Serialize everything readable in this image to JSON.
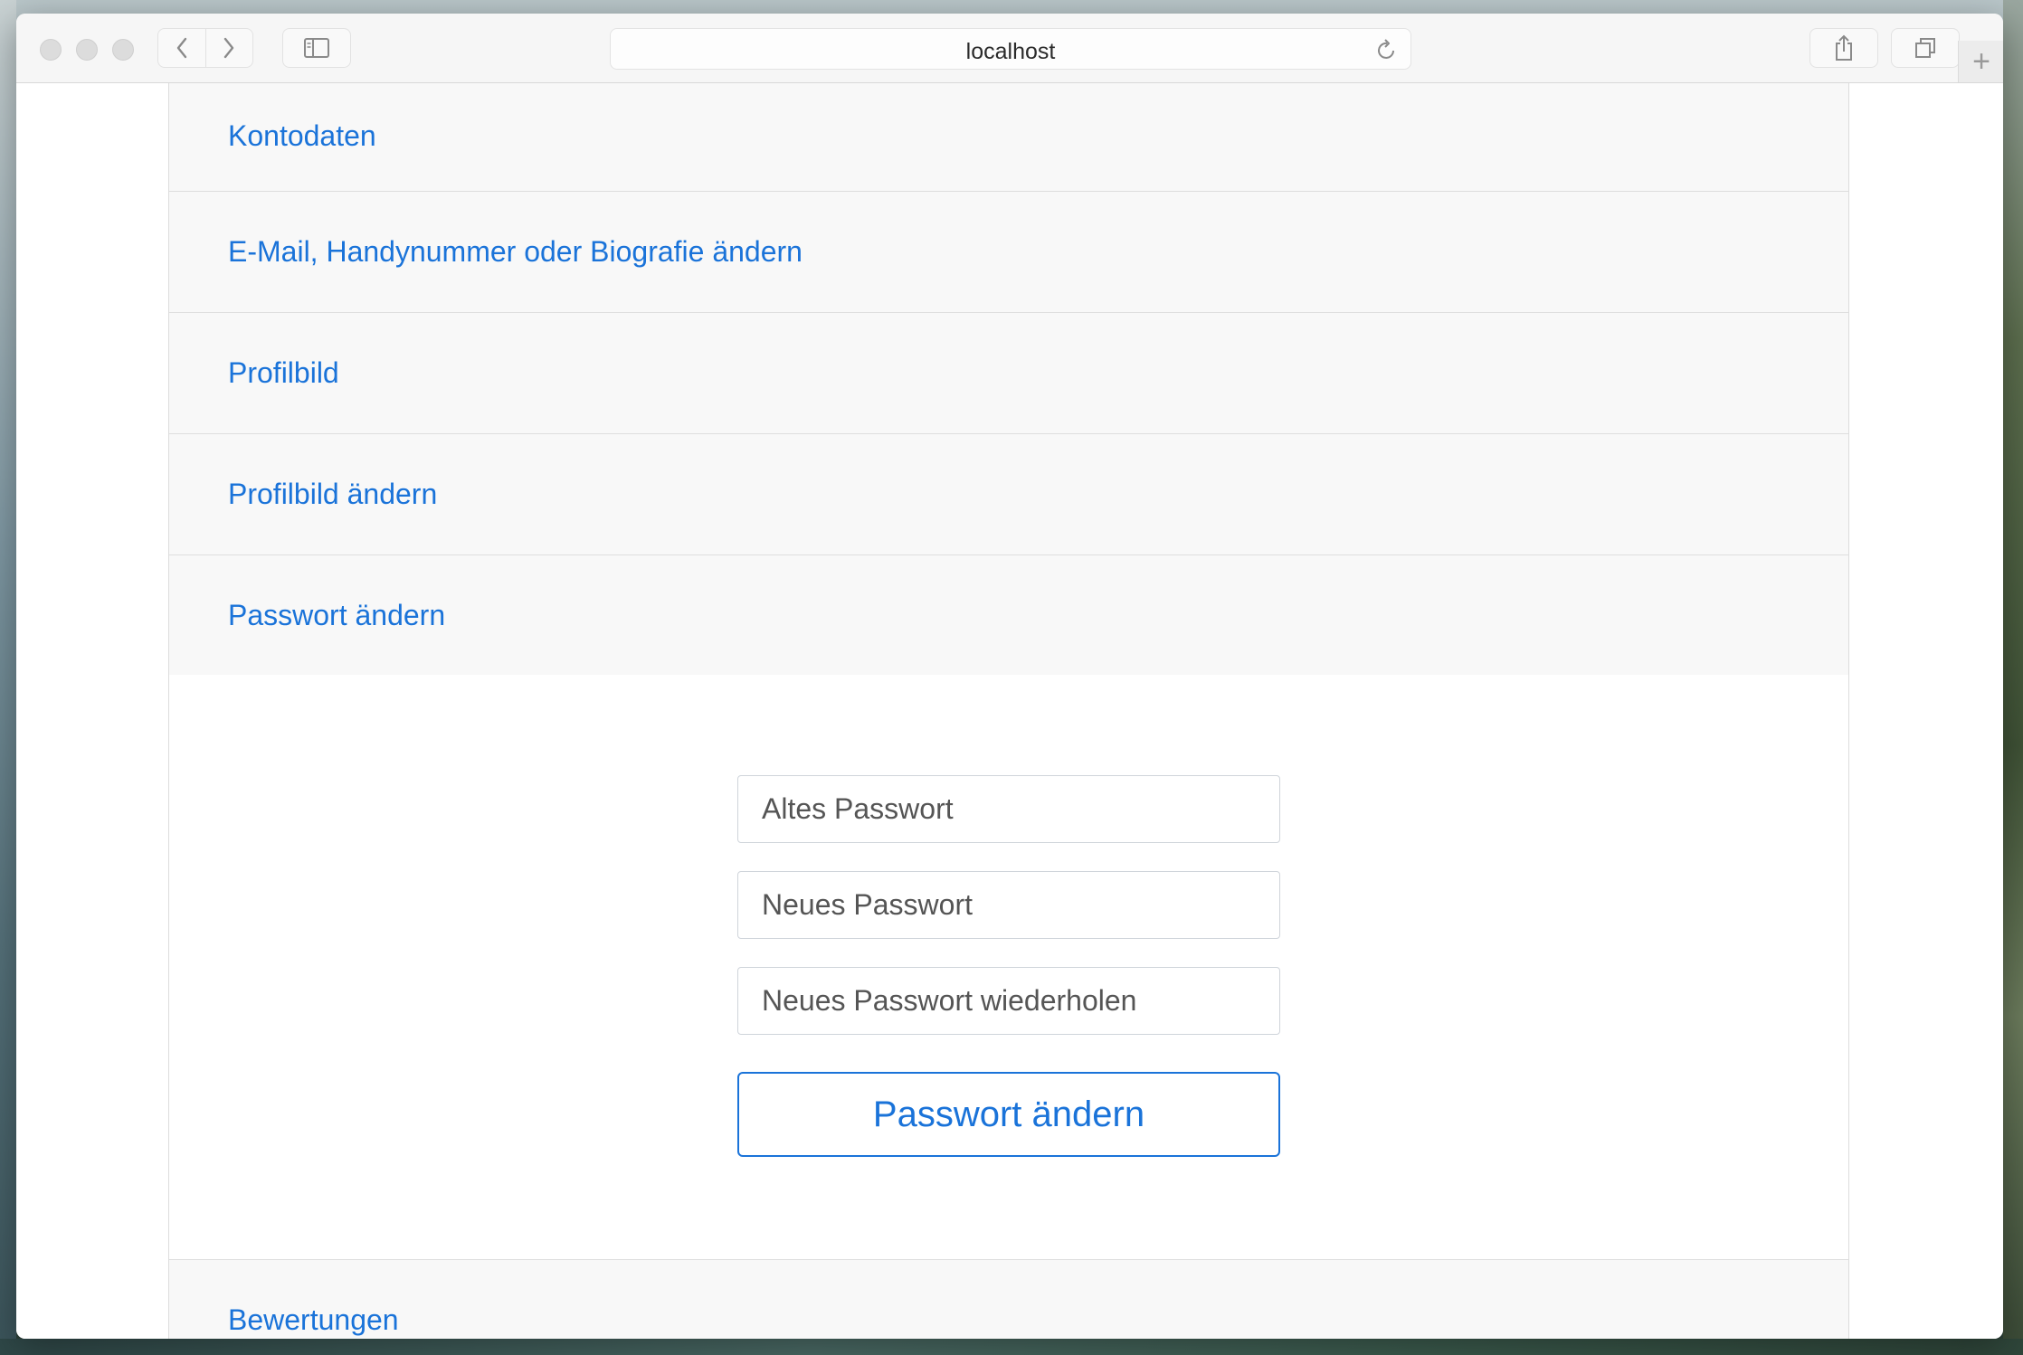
{
  "browser": {
    "address": "localhost",
    "icons": {
      "back": "chevron-left-icon",
      "forward": "chevron-right-icon",
      "sidebar": "sidebar-icon",
      "reload": "reload-icon",
      "share": "share-icon",
      "tabs": "tabs-overview-icon",
      "new_tab": "plus-icon"
    }
  },
  "menu": {
    "items": [
      {
        "label": "Kontodaten"
      },
      {
        "label": "E-Mail, Handynummer oder Biografie ändern"
      },
      {
        "label": "Profilbild"
      },
      {
        "label": "Profilbild ändern"
      },
      {
        "label": "Passwort ändern"
      },
      {
        "label": "Bewertungen"
      }
    ]
  },
  "password_form": {
    "old_password_placeholder": "Altes Passwort",
    "new_password_placeholder": "Neues Passwort",
    "repeat_password_placeholder": "Neues Passwort wiederholen",
    "submit_label": "Passwort ändern"
  },
  "colors": {
    "link": "#1a73d9",
    "item_background": "#f8f8f8"
  }
}
